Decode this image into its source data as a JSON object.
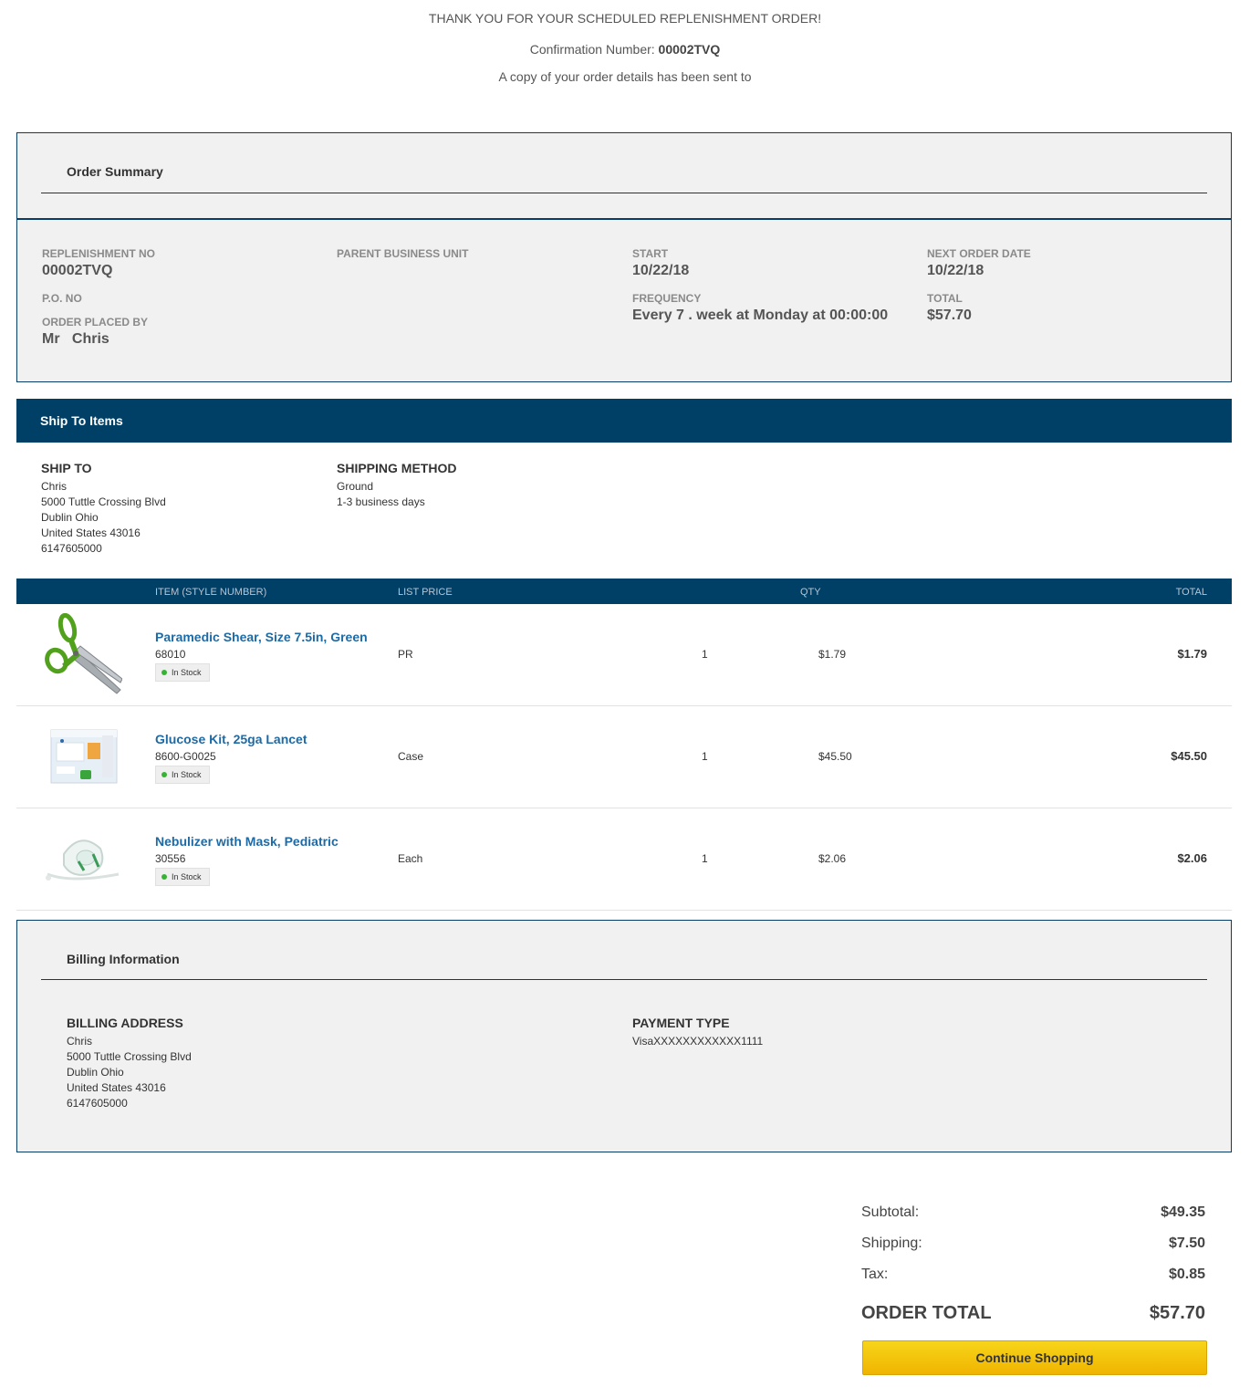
{
  "header": {
    "thank_you": "THANK YOU FOR YOUR SCHEDULED REPLENISHMENT ORDER!",
    "confirmation_label": "Confirmation Number: ",
    "confirmation_number": "00002TVQ",
    "copy_sent": "A copy of your order details has been sent to"
  },
  "order_summary": {
    "title": "Order Summary",
    "replenishment_no_label": "REPLENISHMENT NO",
    "replenishment_no": "00002TVQ",
    "po_no_label": "P.O. NO",
    "order_placed_by_label": "ORDER PLACED BY",
    "order_placed_by": "Mr   Chris",
    "parent_bu_label": "PARENT BUSINESS UNIT",
    "start_label": "START",
    "start": "10/22/18",
    "frequency_label": "FREQUENCY",
    "frequency": "Every 7 . week at Monday at 00:00:00",
    "next_order_date_label": "NEXT ORDER DATE",
    "next_order_date": "10/22/18",
    "total_label": "TOTAL",
    "total": "$57.70"
  },
  "ship_to_items": {
    "title": "Ship To Items",
    "ship_to_label": "SHIP TO",
    "ship_to_lines": [
      "Chris",
      "5000 Tuttle Crossing Blvd",
      "Dublin Ohio",
      "United States 43016",
      "6147605000"
    ],
    "shipping_method_label": "SHIPPING METHOD",
    "shipping_method_lines": [
      "Ground",
      "1-3 business days"
    ]
  },
  "items_table": {
    "columns": {
      "item": "ITEM (STYLE NUMBER)",
      "list_price": "LIST PRICE",
      "qty": "QTY",
      "total": "TOTAL"
    },
    "rows": [
      {
        "name": "Paramedic Shear, Size 7.5in, Green",
        "sku": "68010",
        "stock": "In Stock",
        "unit": "PR",
        "qty": "1",
        "price": "$1.79",
        "total": "$1.79",
        "image": "scissors-image"
      },
      {
        "name": "Glucose Kit, 25ga Lancet",
        "sku": "8600-G0025",
        "stock": "In Stock",
        "unit": "Case",
        "qty": "1",
        "price": "$45.50",
        "total": "$45.50",
        "image": "glucose-kit-image"
      },
      {
        "name": "Nebulizer with Mask, Pediatric",
        "sku": "30556",
        "stock": "In Stock",
        "unit": "Each",
        "qty": "1",
        "price": "$2.06",
        "total": "$2.06",
        "image": "nebulizer-mask-image"
      }
    ]
  },
  "billing": {
    "title": "Billing Information",
    "address_label": "BILLING ADDRESS",
    "address_lines": [
      "Chris",
      "5000 Tuttle Crossing Blvd",
      "Dublin Ohio",
      "United States 43016",
      "6147605000"
    ],
    "payment_type_label": "PAYMENT TYPE",
    "payment_type": "VisaXXXXXXXXXXXX1111"
  },
  "totals": {
    "subtotal_label": "Subtotal:",
    "subtotal": "$49.35",
    "shipping_label": "Shipping:",
    "shipping": "$7.50",
    "tax_label": "Tax:",
    "tax": "$0.85",
    "order_total_label": "ORDER TOTAL",
    "order_total": "$57.70"
  },
  "actions": {
    "continue_shopping": "Continue Shopping"
  },
  "colors": {
    "navy": "#003f66",
    "link_blue": "#1d6aa5",
    "button_yellow": "#f5c60d",
    "in_stock_green": "#35b335"
  }
}
